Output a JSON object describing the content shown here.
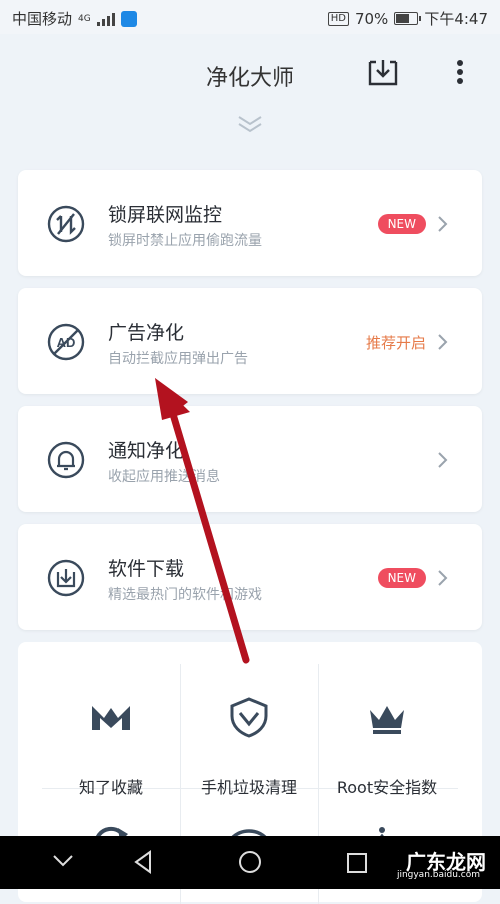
{
  "status_bar": {
    "carrier": "中国移动",
    "network": "4G",
    "hd": "HD",
    "battery": "70%",
    "battery_level": 0.7,
    "time": "下午4:47"
  },
  "header": {
    "title": "净化大师"
  },
  "cards": [
    {
      "title": "锁屏联网监控",
      "subtitle": "锁屏时禁止应用偷跑流量",
      "badge": "NEW"
    },
    {
      "title": "广告净化",
      "subtitle": "自动拦截应用弹出广告",
      "action": "推荐开启"
    },
    {
      "title": "通知净化",
      "subtitle": "收起应用推送消息"
    },
    {
      "title": "软件下载",
      "subtitle": "精选最热门的软件和游戏",
      "badge": "NEW"
    }
  ],
  "grid": {
    "items": [
      {
        "label": "知了收藏",
        "icon": "m-logo-icon"
      },
      {
        "label": "手机垃圾清理",
        "icon": "shield-icon"
      },
      {
        "label": "Root安全指数",
        "icon": "crown-icon"
      }
    ]
  },
  "watermark": {
    "text": "广东龙网",
    "sub": "jingyan.baidu.com"
  },
  "colors": {
    "badge": "#ef4d5f",
    "recommend": "#e67a48",
    "arrow": "#b3121f",
    "brand_dark": "#3a4a5c"
  }
}
